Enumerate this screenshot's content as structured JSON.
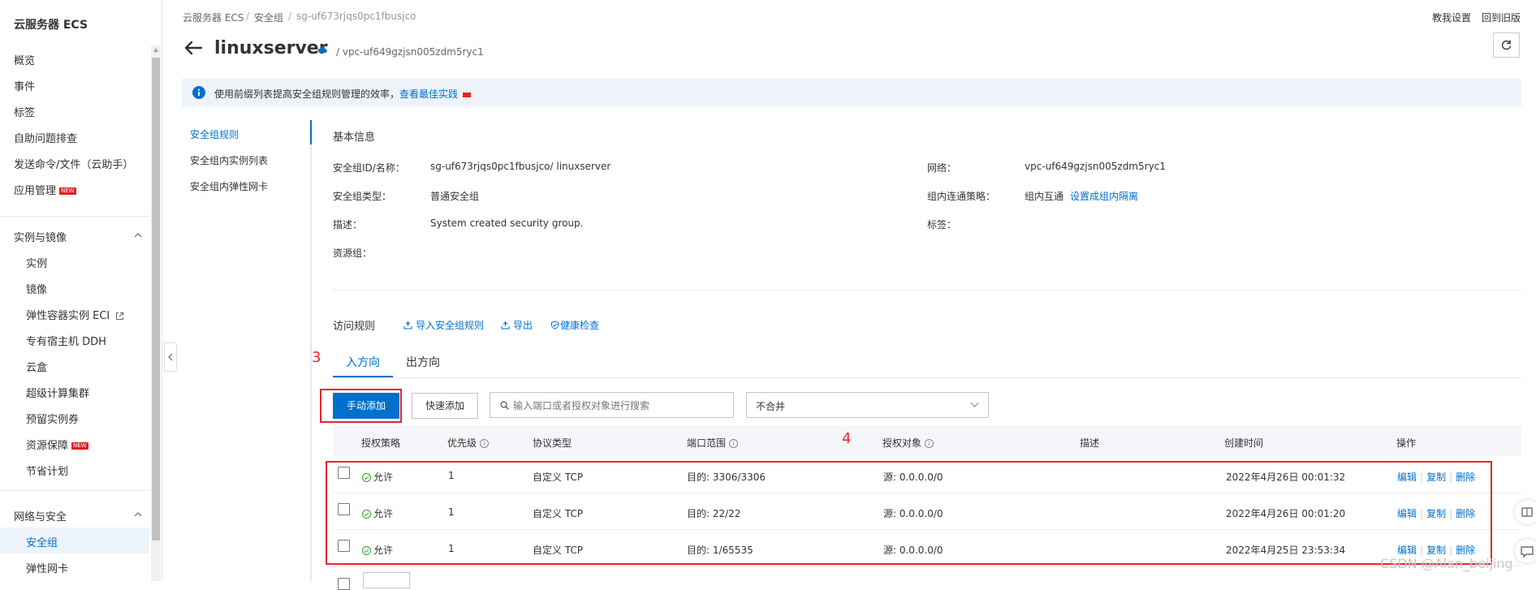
{
  "sidebar": {
    "title": "云服务器 ECS",
    "top_items": [
      {
        "label": "概览"
      },
      {
        "label": "事件"
      },
      {
        "label": "标签"
      },
      {
        "label": "自助问题排查"
      },
      {
        "label": "发送命令/文件（云助手）"
      },
      {
        "label": "应用管理",
        "badge": "NEW"
      }
    ],
    "group1": {
      "label": "实例与镜像",
      "items": [
        {
          "label": "实例"
        },
        {
          "label": "镜像"
        },
        {
          "label": "弹性容器实例 ECI"
        },
        {
          "label": "专有宿主机 DDH"
        },
        {
          "label": "云盒"
        },
        {
          "label": "超级计算集群"
        },
        {
          "label": "预留实例券"
        },
        {
          "label": "资源保障",
          "badge": "NEW"
        },
        {
          "label": "节省计划"
        }
      ]
    },
    "group2": {
      "label": "网络与安全",
      "items": [
        {
          "label": "安全组",
          "selected": true
        },
        {
          "label": "弹性网卡"
        }
      ]
    }
  },
  "header": {
    "breadcrumb": [
      "云服务器 ECS",
      "安全组",
      "sg-uf673rjqs0pc1fbusjco"
    ],
    "sep": "/",
    "top_links": [
      "教我设置",
      "回到旧版"
    ],
    "title": "linuxserver",
    "vpc_sub": "/ vpc-uf649gzjsn005zdm5ryc1"
  },
  "notice": {
    "text": "使用前缀列表提高安全组规则管理的效率，",
    "link": "查看最佳实践"
  },
  "subnav": [
    "安全组规则",
    "安全组内实例列表",
    "安全组内弹性网卡"
  ],
  "basic_info": {
    "section_title": "基本信息",
    "id_name_label": "安全组ID/名称：",
    "id_name_value": "sg-uf673rjqs0pc1fbusjco/ linuxserver",
    "type_label": "安全组类型：",
    "type_value": "普通安全组",
    "desc_label": "描述：",
    "desc_value": "System created security group.",
    "rg_label": "资源组：",
    "network_label": "网络：",
    "network_value": "vpc-uf649gzjsn005zdm5ryc1",
    "policy_label": "组内连通策略：",
    "policy_value": "组内互通",
    "policy_link": "设置成组内隔离",
    "tag_label": "标签："
  },
  "access": {
    "title": "访问规则",
    "import_label": "导入安全组规则",
    "export_label": "导出",
    "health_label": "健康检查"
  },
  "tabs": [
    "入方向",
    "出方向"
  ],
  "annotations": {
    "n3": "3",
    "n4": "4"
  },
  "toolbar": {
    "manual_add": "手动添加",
    "quick_add": "快速添加",
    "search_placeholder": "输入端口或者授权对象进行搜索",
    "merge_value": "不合并"
  },
  "table": {
    "columns": [
      "授权策略",
      "优先级",
      "协议类型",
      "端口范围",
      "授权对象",
      "描述",
      "创建时间",
      "操作"
    ],
    "rows": [
      {
        "policy": "允许",
        "priority": "1",
        "protocol": "自定义 TCP",
        "port": "目的: 3306/3306",
        "source": "源: 0.0.0.0/0",
        "desc": "",
        "created": "2022年4月26日 00:01:32"
      },
      {
        "policy": "允许",
        "priority": "1",
        "protocol": "自定义 TCP",
        "port": "目的: 22/22",
        "source": "源: 0.0.0.0/0",
        "desc": "",
        "created": "2022年4月26日 00:01:20"
      },
      {
        "policy": "允许",
        "priority": "1",
        "protocol": "自定义 TCP",
        "port": "目的: 1/65535",
        "source": "源: 0.0.0.0/0",
        "desc": "",
        "created": "2022年4月25日 23:53:34"
      }
    ],
    "ops": [
      "编辑",
      "复制",
      "删除"
    ]
  },
  "watermark": "CSDN @Alan_beijing",
  "colors": {
    "primary": "#0070cc",
    "annotation": "#e8262a",
    "allow": "#2fa52f",
    "new_badge": "#e02020"
  }
}
